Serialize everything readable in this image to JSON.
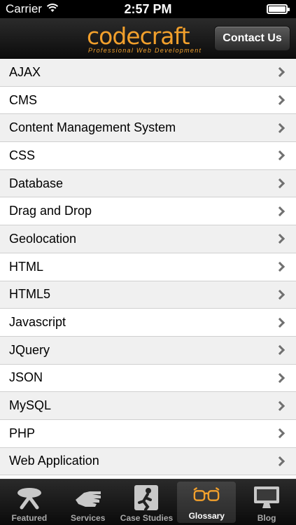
{
  "status": {
    "carrier": "Carrier",
    "time": "2:57 PM"
  },
  "header": {
    "logo_main_1": "code",
    "logo_main_2": "craft",
    "logo_tagline": "Professional Web Development",
    "contact_label": "Contact Us"
  },
  "glossary": {
    "items": [
      "AJAX",
      "CMS",
      "Content Management System",
      "CSS",
      "Database",
      "Drag and Drop",
      "Geolocation",
      "HTML",
      "HTML5",
      "Javascript",
      "JQuery",
      "JSON",
      "MySQL",
      "PHP",
      "Web Application"
    ]
  },
  "tabs": [
    {
      "label": "Featured",
      "icon": "featured-icon"
    },
    {
      "label": "Services",
      "icon": "hand-icon"
    },
    {
      "label": "Case Studies",
      "icon": "person-icon"
    },
    {
      "label": "Glossary",
      "icon": "glasses-icon"
    },
    {
      "label": "Blog",
      "icon": "monitor-icon"
    }
  ],
  "active_tab": "Glossary",
  "colors": {
    "brand": "#f2a02c"
  }
}
